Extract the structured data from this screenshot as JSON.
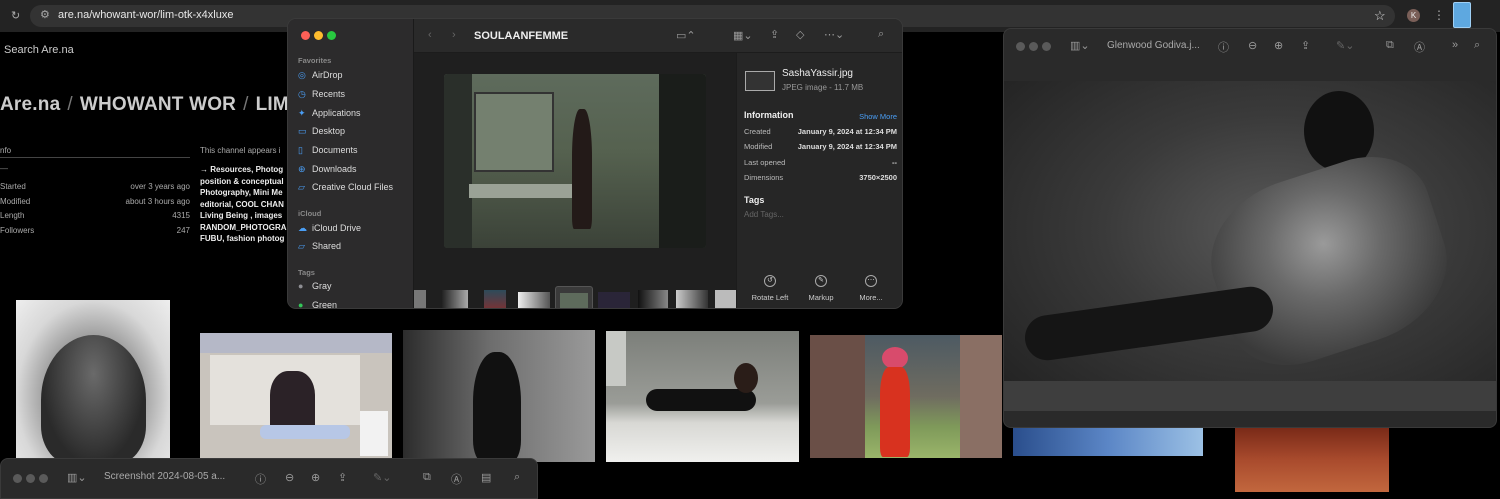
{
  "browser": {
    "url": "are.na/whowant-wor/lim-otk-x4xluxe",
    "profile_initial": "K"
  },
  "arena": {
    "search_placeholder": "Search Are.na",
    "breadcrumb": [
      "Are.na",
      "WHOWANT WOR",
      "LIM"
    ],
    "info_header": "nfo",
    "info_dash": "—",
    "info_rows": [
      {
        "label": "Started",
        "value": "over 3 years ago"
      },
      {
        "label": "Modified",
        "value": "about 3 hours ago"
      },
      {
        "label": "Length",
        "value": "4315"
      },
      {
        "label": "Followers",
        "value": "247"
      }
    ],
    "channel_note": "This channel appears i",
    "channel_links": "→ Resources, Photog position & conceptual Photography, Mini Me editorial, COOL CHAN Living Being , images RANDOM_PHOTOGRA FUBU, fashion photog"
  },
  "finder": {
    "folder": "SOULAANFEMME",
    "sidebar": {
      "favorites_head": "Favorites",
      "favorites": [
        {
          "label": "AirDrop",
          "icon": "airdrop-icon"
        },
        {
          "label": "Recents",
          "icon": "clock-icon"
        },
        {
          "label": "Applications",
          "icon": "apps-icon"
        },
        {
          "label": "Desktop",
          "icon": "desktop-icon"
        },
        {
          "label": "Documents",
          "icon": "document-icon"
        },
        {
          "label": "Downloads",
          "icon": "download-icon"
        },
        {
          "label": "Creative Cloud Files",
          "icon": "folder-icon"
        }
      ],
      "icloud_head": "iCloud",
      "icloud": [
        {
          "label": "iCloud Drive",
          "icon": "cloud-icon"
        },
        {
          "label": "Shared",
          "icon": "shared-folder-icon"
        }
      ],
      "tags_head": "Tags",
      "tags": [
        {
          "label": "Gray",
          "color": "#8e8e93"
        },
        {
          "label": "Green",
          "color": "#34c759"
        }
      ]
    },
    "file": {
      "name": "SashaYassir.jpg",
      "kind": "JPEG image - 11.7 MB",
      "info_head": "Information",
      "show_more": "Show More",
      "rows": [
        {
          "label": "Created",
          "value": "January 9, 2024 at 12:34 PM"
        },
        {
          "label": "Modified",
          "value": "January 9, 2024 at 12:34 PM"
        },
        {
          "label": "Last opened",
          "value": "--"
        },
        {
          "label": "Dimensions",
          "value": "3750×2500"
        }
      ],
      "tags_head": "Tags",
      "add_tags": "Add Tags..."
    },
    "actions": [
      "Rotate Left",
      "Markup",
      "More..."
    ]
  },
  "preview": {
    "title": "Glenwood Godiva.j..."
  },
  "bottom_window": {
    "title": "Screenshot 2024-08-05 a..."
  },
  "colors": {
    "close": "#fe5f57",
    "minimize": "#febc2e",
    "zoom": "#28c840",
    "accent": "#4a9ef5"
  }
}
